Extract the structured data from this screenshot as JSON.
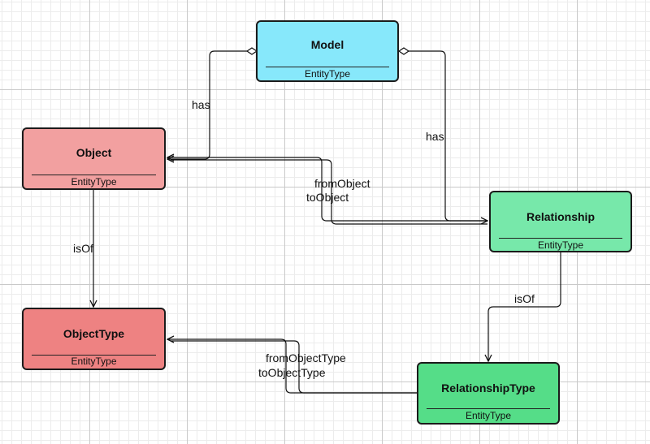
{
  "nodes": {
    "model": {
      "title": "Model",
      "subtitle": "EntityType",
      "color": "#87e8fb"
    },
    "object": {
      "title": "Object",
      "subtitle": "EntityType",
      "color": "#f2a0a0"
    },
    "relationship": {
      "title": "Relationship",
      "subtitle": "EntityType",
      "color": "#77e8aa"
    },
    "objecttype": {
      "title": "ObjectType",
      "subtitle": "EntityType",
      "color": "#ee8282"
    },
    "relationshiptype": {
      "title": "RelationshipType",
      "subtitle": "EntityType",
      "color": "#55dd88"
    }
  },
  "edges": {
    "model_object_has": "has",
    "model_relationship_has": "has",
    "relationship_from_object": "fromObject",
    "relationship_to_object": "toObject",
    "object_isof": "isOf",
    "relationship_isof": "isOf",
    "reltype_from_objecttype": "fromObjectType",
    "reltype_to_objecttype": "toObjectType"
  }
}
